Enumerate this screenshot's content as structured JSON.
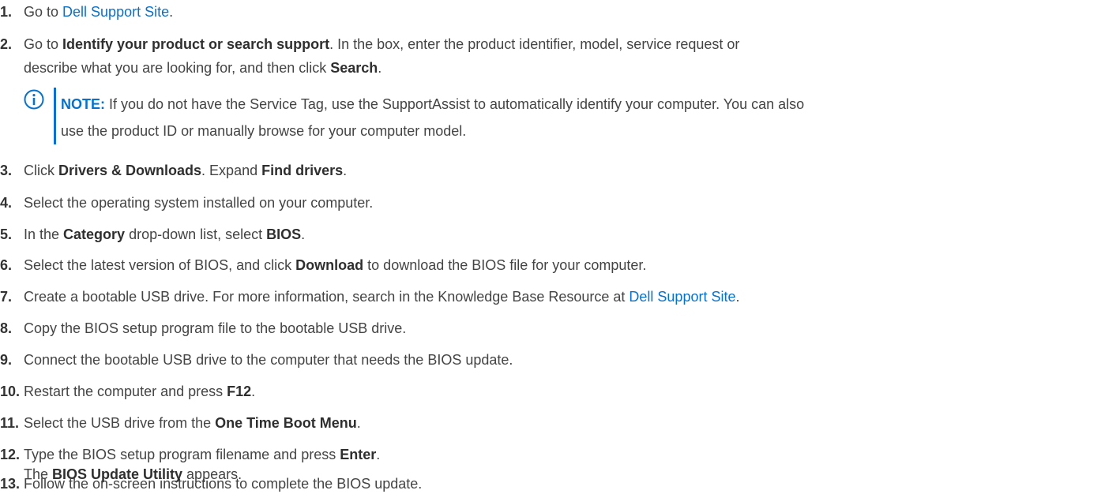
{
  "steps": [
    {
      "num": "1.",
      "parts": [
        {
          "t": "Go to "
        },
        {
          "t": "Dell Support Site",
          "link": true
        },
        {
          "t": "."
        }
      ]
    },
    {
      "num": "2.",
      "parts": [
        {
          "t": "Go to "
        },
        {
          "t": "Identify your product or search support",
          "b": true
        },
        {
          "t": ". In the box, enter the product identifier, model, service request or"
        }
      ],
      "line2": [
        {
          "t": "describe what you are looking for, and then click "
        },
        {
          "t": "Search",
          "b": true
        },
        {
          "t": "."
        }
      ]
    },
    {
      "num": "3.",
      "parts": [
        {
          "t": "Click "
        },
        {
          "t": "Drivers & Downloads",
          "b": true
        },
        {
          "t": ". Expand "
        },
        {
          "t": "Find drivers",
          "b": true
        },
        {
          "t": "."
        }
      ]
    },
    {
      "num": "4.",
      "parts": [
        {
          "t": "Select the operating system installed on your computer."
        }
      ]
    },
    {
      "num": "5.",
      "parts": [
        {
          "t": "In the "
        },
        {
          "t": "Category",
          "b": true
        },
        {
          "t": " drop-down list, select "
        },
        {
          "t": "BIOS",
          "b": true
        },
        {
          "t": "."
        }
      ]
    },
    {
      "num": "6.",
      "parts": [
        {
          "t": "Select the latest version of BIOS, and click "
        },
        {
          "t": "Download",
          "b": true
        },
        {
          "t": " to download the BIOS file for your computer."
        }
      ]
    },
    {
      "num": "7.",
      "parts": [
        {
          "t": "Create a bootable USB drive. For more information, search in the Knowledge Base Resource at "
        },
        {
          "t": "Dell Support Site",
          "link": true
        },
        {
          "t": "."
        }
      ]
    },
    {
      "num": "8.",
      "parts": [
        {
          "t": "Copy the BIOS setup program file to the bootable USB drive."
        }
      ]
    },
    {
      "num": "9.",
      "parts": [
        {
          "t": "Connect the bootable USB drive to the computer that needs the BIOS update."
        }
      ]
    },
    {
      "num": "10.",
      "parts": [
        {
          "t": "Restart the computer and press "
        },
        {
          "t": "F12",
          "b": true
        },
        {
          "t": "."
        }
      ]
    },
    {
      "num": "11.",
      "parts": [
        {
          "t": "Select the USB drive from the "
        },
        {
          "t": "One Time Boot Menu",
          "b": true
        },
        {
          "t": "."
        }
      ]
    },
    {
      "num": "12.",
      "parts": [
        {
          "t": "Type the BIOS setup program filename and press "
        },
        {
          "t": "Enter",
          "b": true
        },
        {
          "t": "."
        }
      ],
      "line2": [
        {
          "t": "The "
        },
        {
          "t": "BIOS Update Utility",
          "b": true
        },
        {
          "t": " appears."
        }
      ]
    },
    {
      "num": "13.",
      "parts": [
        {
          "t": "Follow the on-screen instructions to complete the BIOS update."
        }
      ]
    }
  ],
  "note": {
    "icon": "info-icon",
    "label": "NOTE:",
    "line1": " If you do not have the Service Tag, use the SupportAssist to automatically identify your computer. You can also",
    "line2": "use the product ID or manually browse for your computer model."
  },
  "colors": {
    "link": "#0672cb",
    "text": "#444444",
    "note_accent": "#0672cb"
  }
}
